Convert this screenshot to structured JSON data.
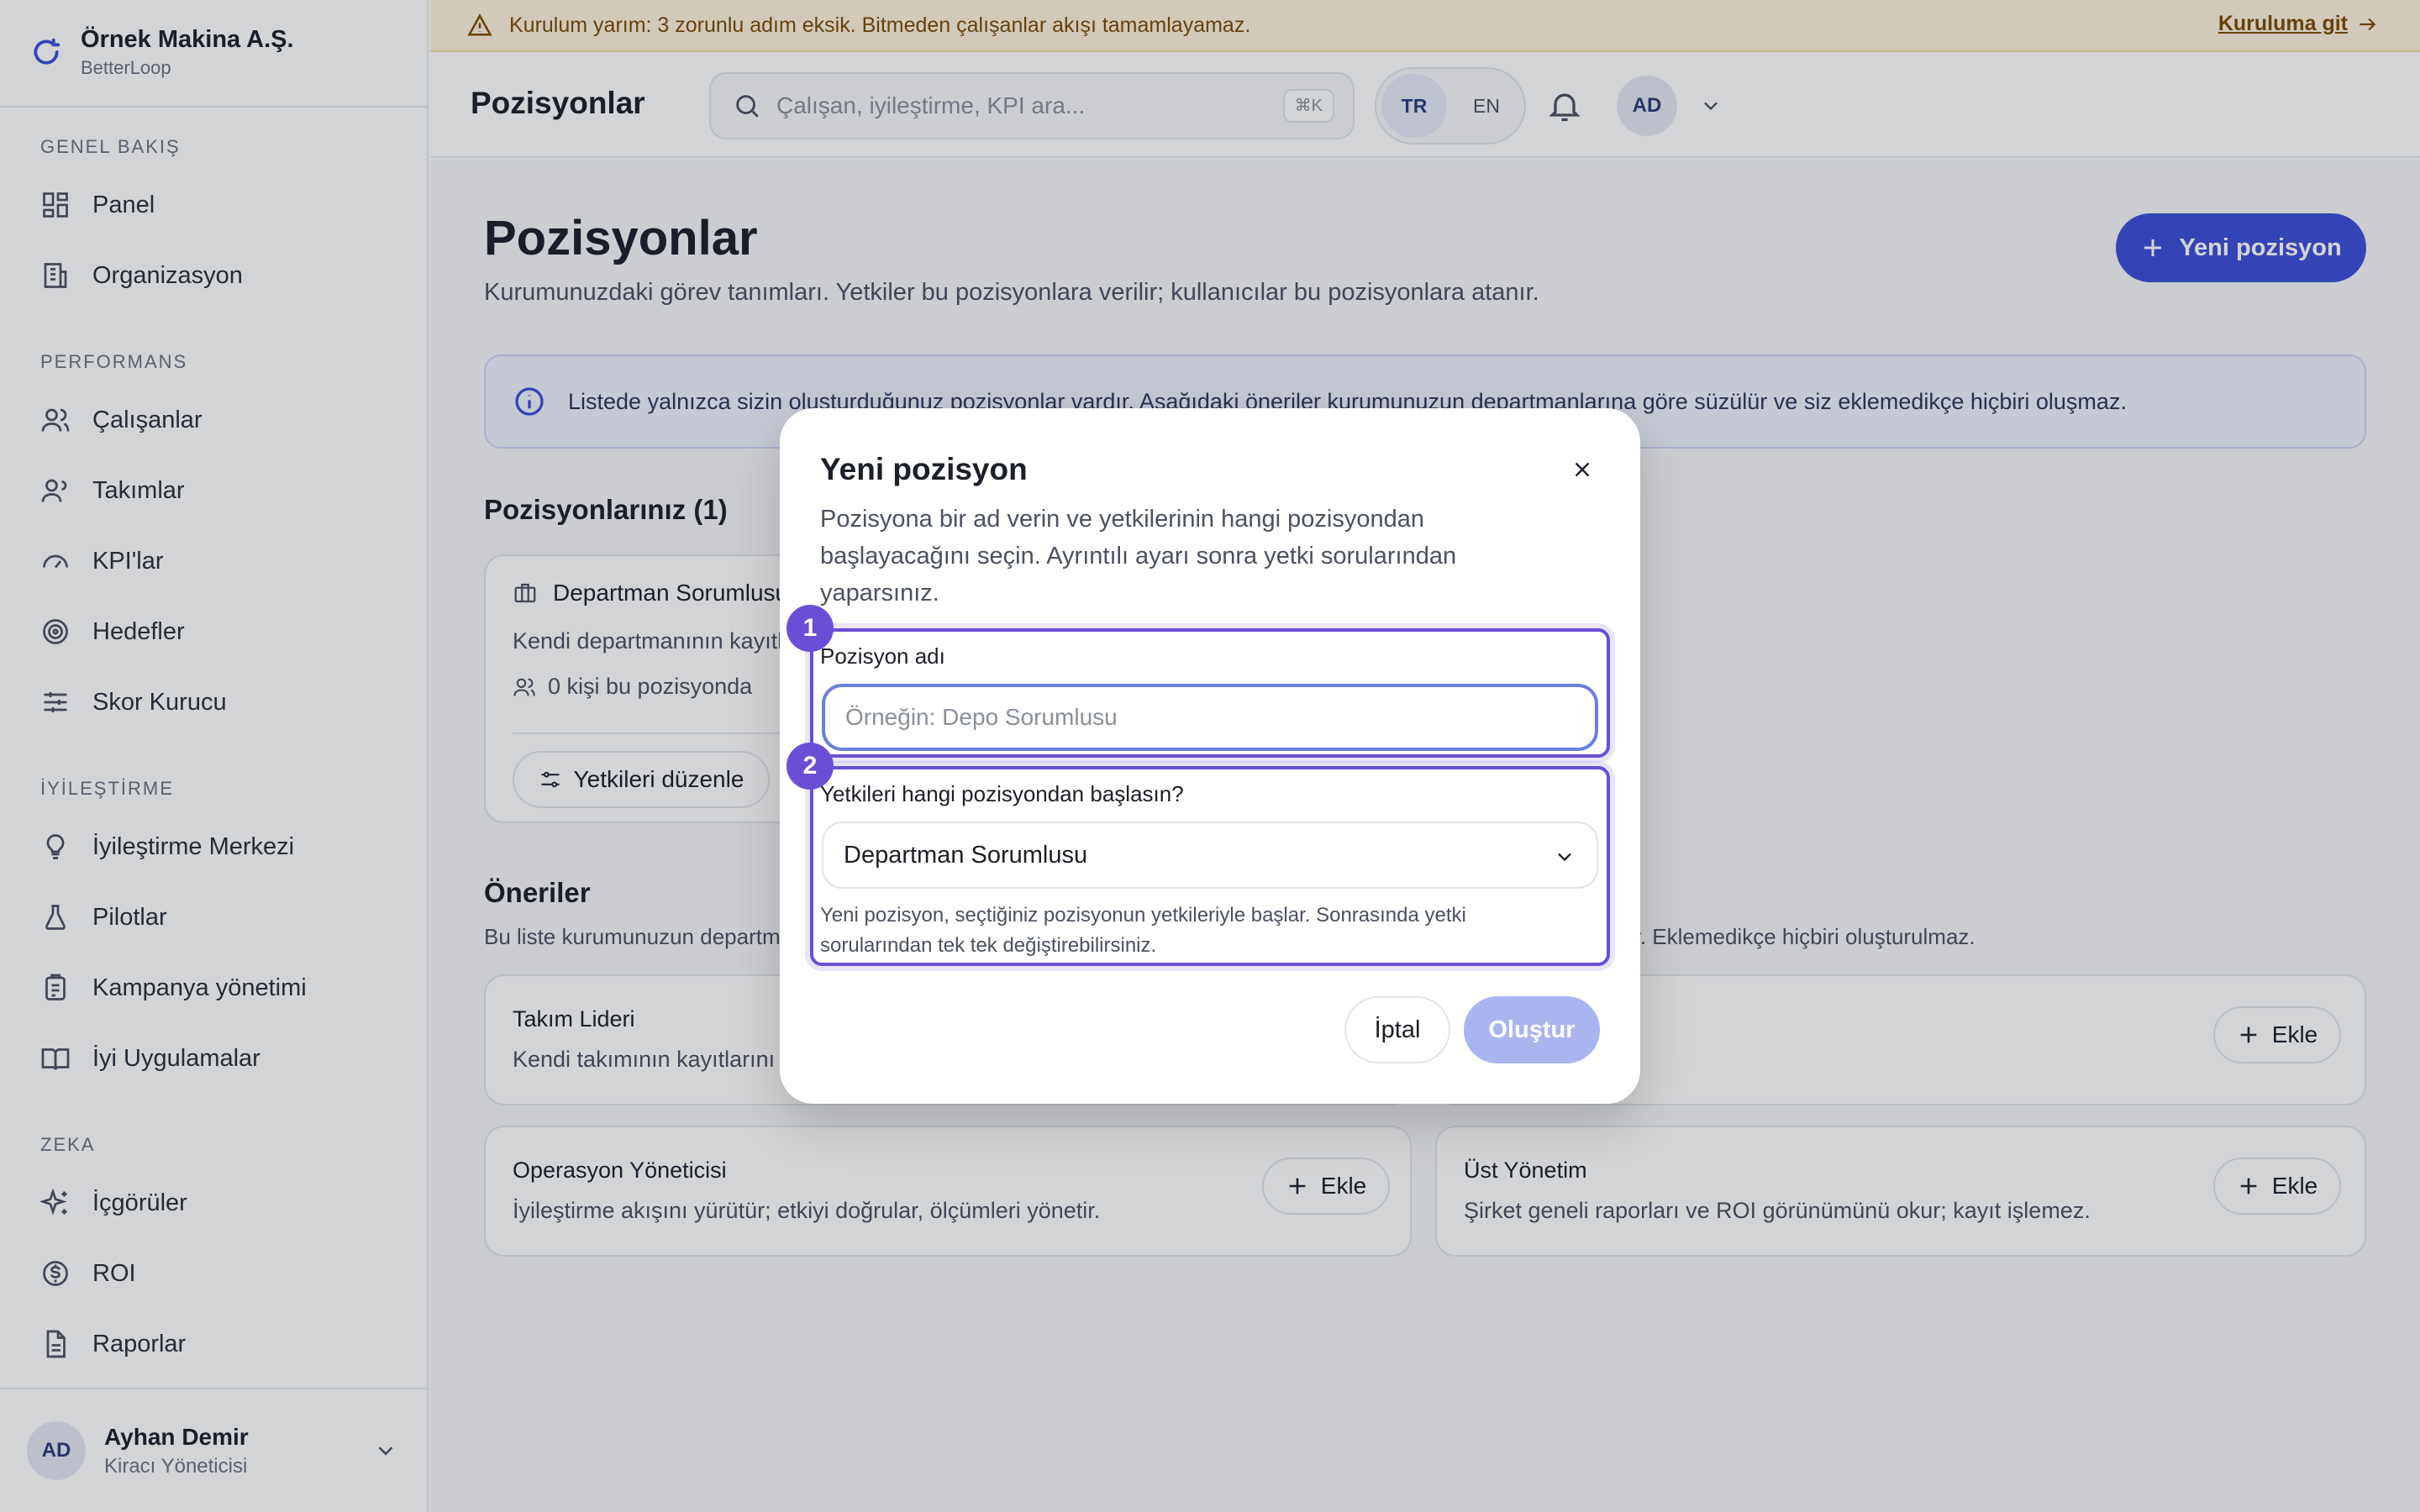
{
  "brand": {
    "name": "Örnek Makina A.Ş.",
    "sub": "BetterLoop"
  },
  "sidebar": {
    "sections": [
      {
        "title": "GENEL BAKIŞ"
      },
      {
        "title": "PERFORMANS"
      },
      {
        "title": "İYİLEŞTİRME"
      },
      {
        "title": "ZEKA"
      }
    ],
    "items": [
      {
        "label": "Panel",
        "icon": "dashboard-icon"
      },
      {
        "label": "Organizasyon",
        "icon": "building-icon"
      },
      {
        "label": "Çalışanlar",
        "icon": "users-icon"
      },
      {
        "label": "Takımlar",
        "icon": "team-icon"
      },
      {
        "label": "KPI'lar",
        "icon": "gauge-icon"
      },
      {
        "label": "Hedefler",
        "icon": "target-icon"
      },
      {
        "label": "Skor Kurucu",
        "icon": "sliders-icon"
      },
      {
        "label": "İyileştirme Merkezi",
        "icon": "lightbulb-icon"
      },
      {
        "label": "Pilotlar",
        "icon": "flask-icon"
      },
      {
        "label": "Kampanya yönetimi",
        "icon": "clipboard-icon"
      },
      {
        "label": "İyi Uygulamalar",
        "icon": "book-icon"
      },
      {
        "label": "İçgörüler",
        "icon": "sparkles-icon"
      },
      {
        "label": "ROI",
        "icon": "dollar-icon"
      },
      {
        "label": "Raporlar",
        "icon": "document-icon"
      }
    ],
    "user": {
      "initials": "AD",
      "name": "Ayhan Demir",
      "role": "Kiracı Yöneticisi"
    }
  },
  "warning": {
    "text": "Kurulum yarım: 3 zorunlu adım eksik. Bitmeden çalışanlar akışı tamamlayamaz.",
    "link": "Kuruluma git"
  },
  "header": {
    "title": "Pozisyonlar",
    "search_placeholder": "Çalışan, iyileştirme, KPI ara...",
    "shortcut": "⌘K",
    "lang_tr": "TR",
    "lang_en": "EN",
    "avatar": "AD"
  },
  "page": {
    "title": "Pozisyonlar",
    "subtitle": "Kurumunuzdaki görev tanımları. Yetkiler bu pozisyonlara verilir; kullanıcılar bu pozisyonlara atanır.",
    "new_button": "Yeni pozisyon",
    "info": "Listede yalnızca sizin oluşturduğunuz pozisyonlar vardır. Aşağıdaki öneriler kurumunuzun departmanlarına göre süzülür ve siz eklemedikçe hiçbiri oluşmaz.",
    "positions_title": "Pozisyonlarınız (1)",
    "position": {
      "name": "Departman Sorumlusu",
      "desc": "Kendi departmanının kayıtlarını yönetir.",
      "count": "0 kişi bu pozisyonda",
      "edit_button": "Yetkileri düzenle"
    },
    "suggestions_title": "Öneriler",
    "suggestions_sub": "Bu liste kurumunuzun departmanlarına göre süzülür; bir öneri yalnızca ilgili departman kurumunuzda tanımlıysa görünür. Eklemedikçe hiçbiri oluşturulmaz.",
    "suggestions": [
      {
        "name": "Takım Lideri",
        "desc": "Kendi takımının kayıtlarını yönetir, ödül taleplerini onaylar, gelişim planlarını izler.",
        "button": "Ekle"
      },
      {
        "name": "Operasyon Yöneticisi",
        "desc": "İyileştirme akışını yürütür; etkiyi doğrular, ölçümleri yönetir.",
        "button": "Ekle"
      },
      {
        "name": "Üst Yönetim",
        "desc": "Şirket geneli raporları ve ROI görünümünü okur; kayıt işlemez.",
        "button": "Ekle"
      }
    ]
  },
  "modal": {
    "title": "Yeni pozisyon",
    "desc": "Pozisyona bir ad verin ve yetkilerinin hangi pozisyondan başlayacağını seçin. Ayrıntılı ayarı sonra yetki sorularından yaparsınız.",
    "step1": "1",
    "step2": "2",
    "name_label": "Pozisyon adı",
    "name_placeholder": "Örneğin: Depo Sorumlusu",
    "base_label": "Yetkileri hangi pozisyondan başlasın?",
    "base_value": "Departman Sorumlusu",
    "hint": "Yeni pozisyon, seçtiğiniz pozisyonun yetkileriyle başlar. Sonrasında yetki sorularından tek tek değiştirebilirsiniz.",
    "cancel": "İptal",
    "create": "Oluştur"
  },
  "colors": {
    "accent": "#3b4fd8",
    "step": "#6a4fd6",
    "warning_bg": "#fdf3dc",
    "warning_text": "#7a4a07"
  }
}
